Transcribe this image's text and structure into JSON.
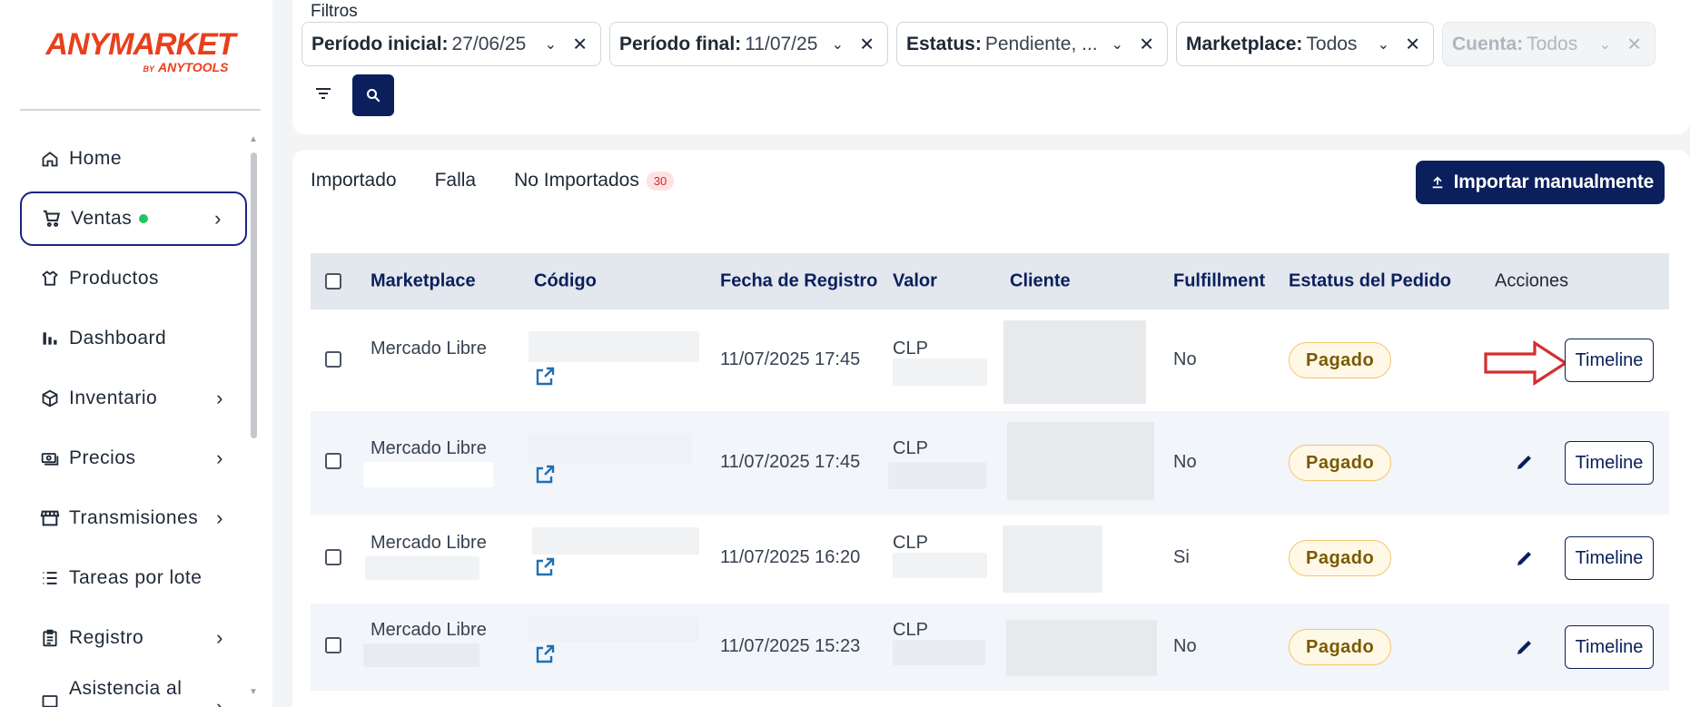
{
  "brand": {
    "name": "ANYMARKET",
    "by": "BY",
    "sub": "ANYTOOLS"
  },
  "sidebar": {
    "items": [
      {
        "label": "Home",
        "icon": "home-icon",
        "chevron": false
      },
      {
        "label": "Ventas",
        "icon": "cart-icon",
        "chevron": true,
        "active": true,
        "dot": true
      },
      {
        "label": "Productos",
        "icon": "shirt-icon",
        "chevron": false
      },
      {
        "label": "Dashboard",
        "icon": "bar-chart-icon",
        "chevron": false
      },
      {
        "label": "Inventario",
        "icon": "box-icon",
        "chevron": true
      },
      {
        "label": "Precios",
        "icon": "price-icon",
        "chevron": true
      },
      {
        "label": "Transmisiones",
        "icon": "store-icon",
        "chevron": true
      },
      {
        "label": "Tareas por lote",
        "icon": "list-icon",
        "chevron": false
      },
      {
        "label": "Registro",
        "icon": "clipboard-icon",
        "chevron": true
      },
      {
        "label": "Asistencia al",
        "icon": "help-icon",
        "chevron": true
      }
    ]
  },
  "filters": {
    "title": "Filtros",
    "chips": [
      {
        "label": "Período inicial:",
        "value": "27/06/25"
      },
      {
        "label": "Período final:",
        "value": "11/07/25"
      },
      {
        "label": "Estatus:",
        "value": "Pendiente, ..."
      },
      {
        "label": "Marketplace:",
        "value": "Todos"
      },
      {
        "label": "Cuenta:",
        "value": "Todos",
        "disabled": true
      }
    ]
  },
  "tabs": [
    {
      "label": "Importado",
      "active": true
    },
    {
      "label": "Falla"
    },
    {
      "label": "No Importados",
      "badge": "30"
    }
  ],
  "import_button": "Importar manualmente",
  "table": {
    "headers": {
      "marketplace": "Marketplace",
      "codigo": "Código",
      "fecha": "Fecha de Registro",
      "valor": "Valor",
      "cliente": "Cliente",
      "fulfillment": "Fulfillment",
      "estatus": "Estatus del Pedido",
      "acciones": "Acciones"
    },
    "rows": [
      {
        "marketplace": "Mercado Libre",
        "fecha": "11/07/2025 17:45",
        "valor": "CLP",
        "fulfillment": "No",
        "estatus": "Pagado",
        "action": "Timeline"
      },
      {
        "marketplace": "Mercado Libre",
        "fecha": "11/07/2025 17:45",
        "valor": "CLP",
        "fulfillment": "No",
        "estatus": "Pagado",
        "action": "Timeline"
      },
      {
        "marketplace": "Mercado Libre",
        "fecha": "11/07/2025 16:20",
        "valor": "CLP",
        "fulfillment": "Si",
        "estatus": "Pagado",
        "action": "Timeline"
      },
      {
        "marketplace": "Mercado Libre",
        "fecha": "11/07/2025 15:23",
        "valor": "CLP",
        "fulfillment": "No",
        "estatus": "Pagado",
        "action": "Timeline"
      }
    ]
  },
  "colors": {
    "brand": "#e8401c",
    "primary": "#0a1f5c",
    "success": "#22c55e",
    "annotation": "#d32f2f"
  }
}
